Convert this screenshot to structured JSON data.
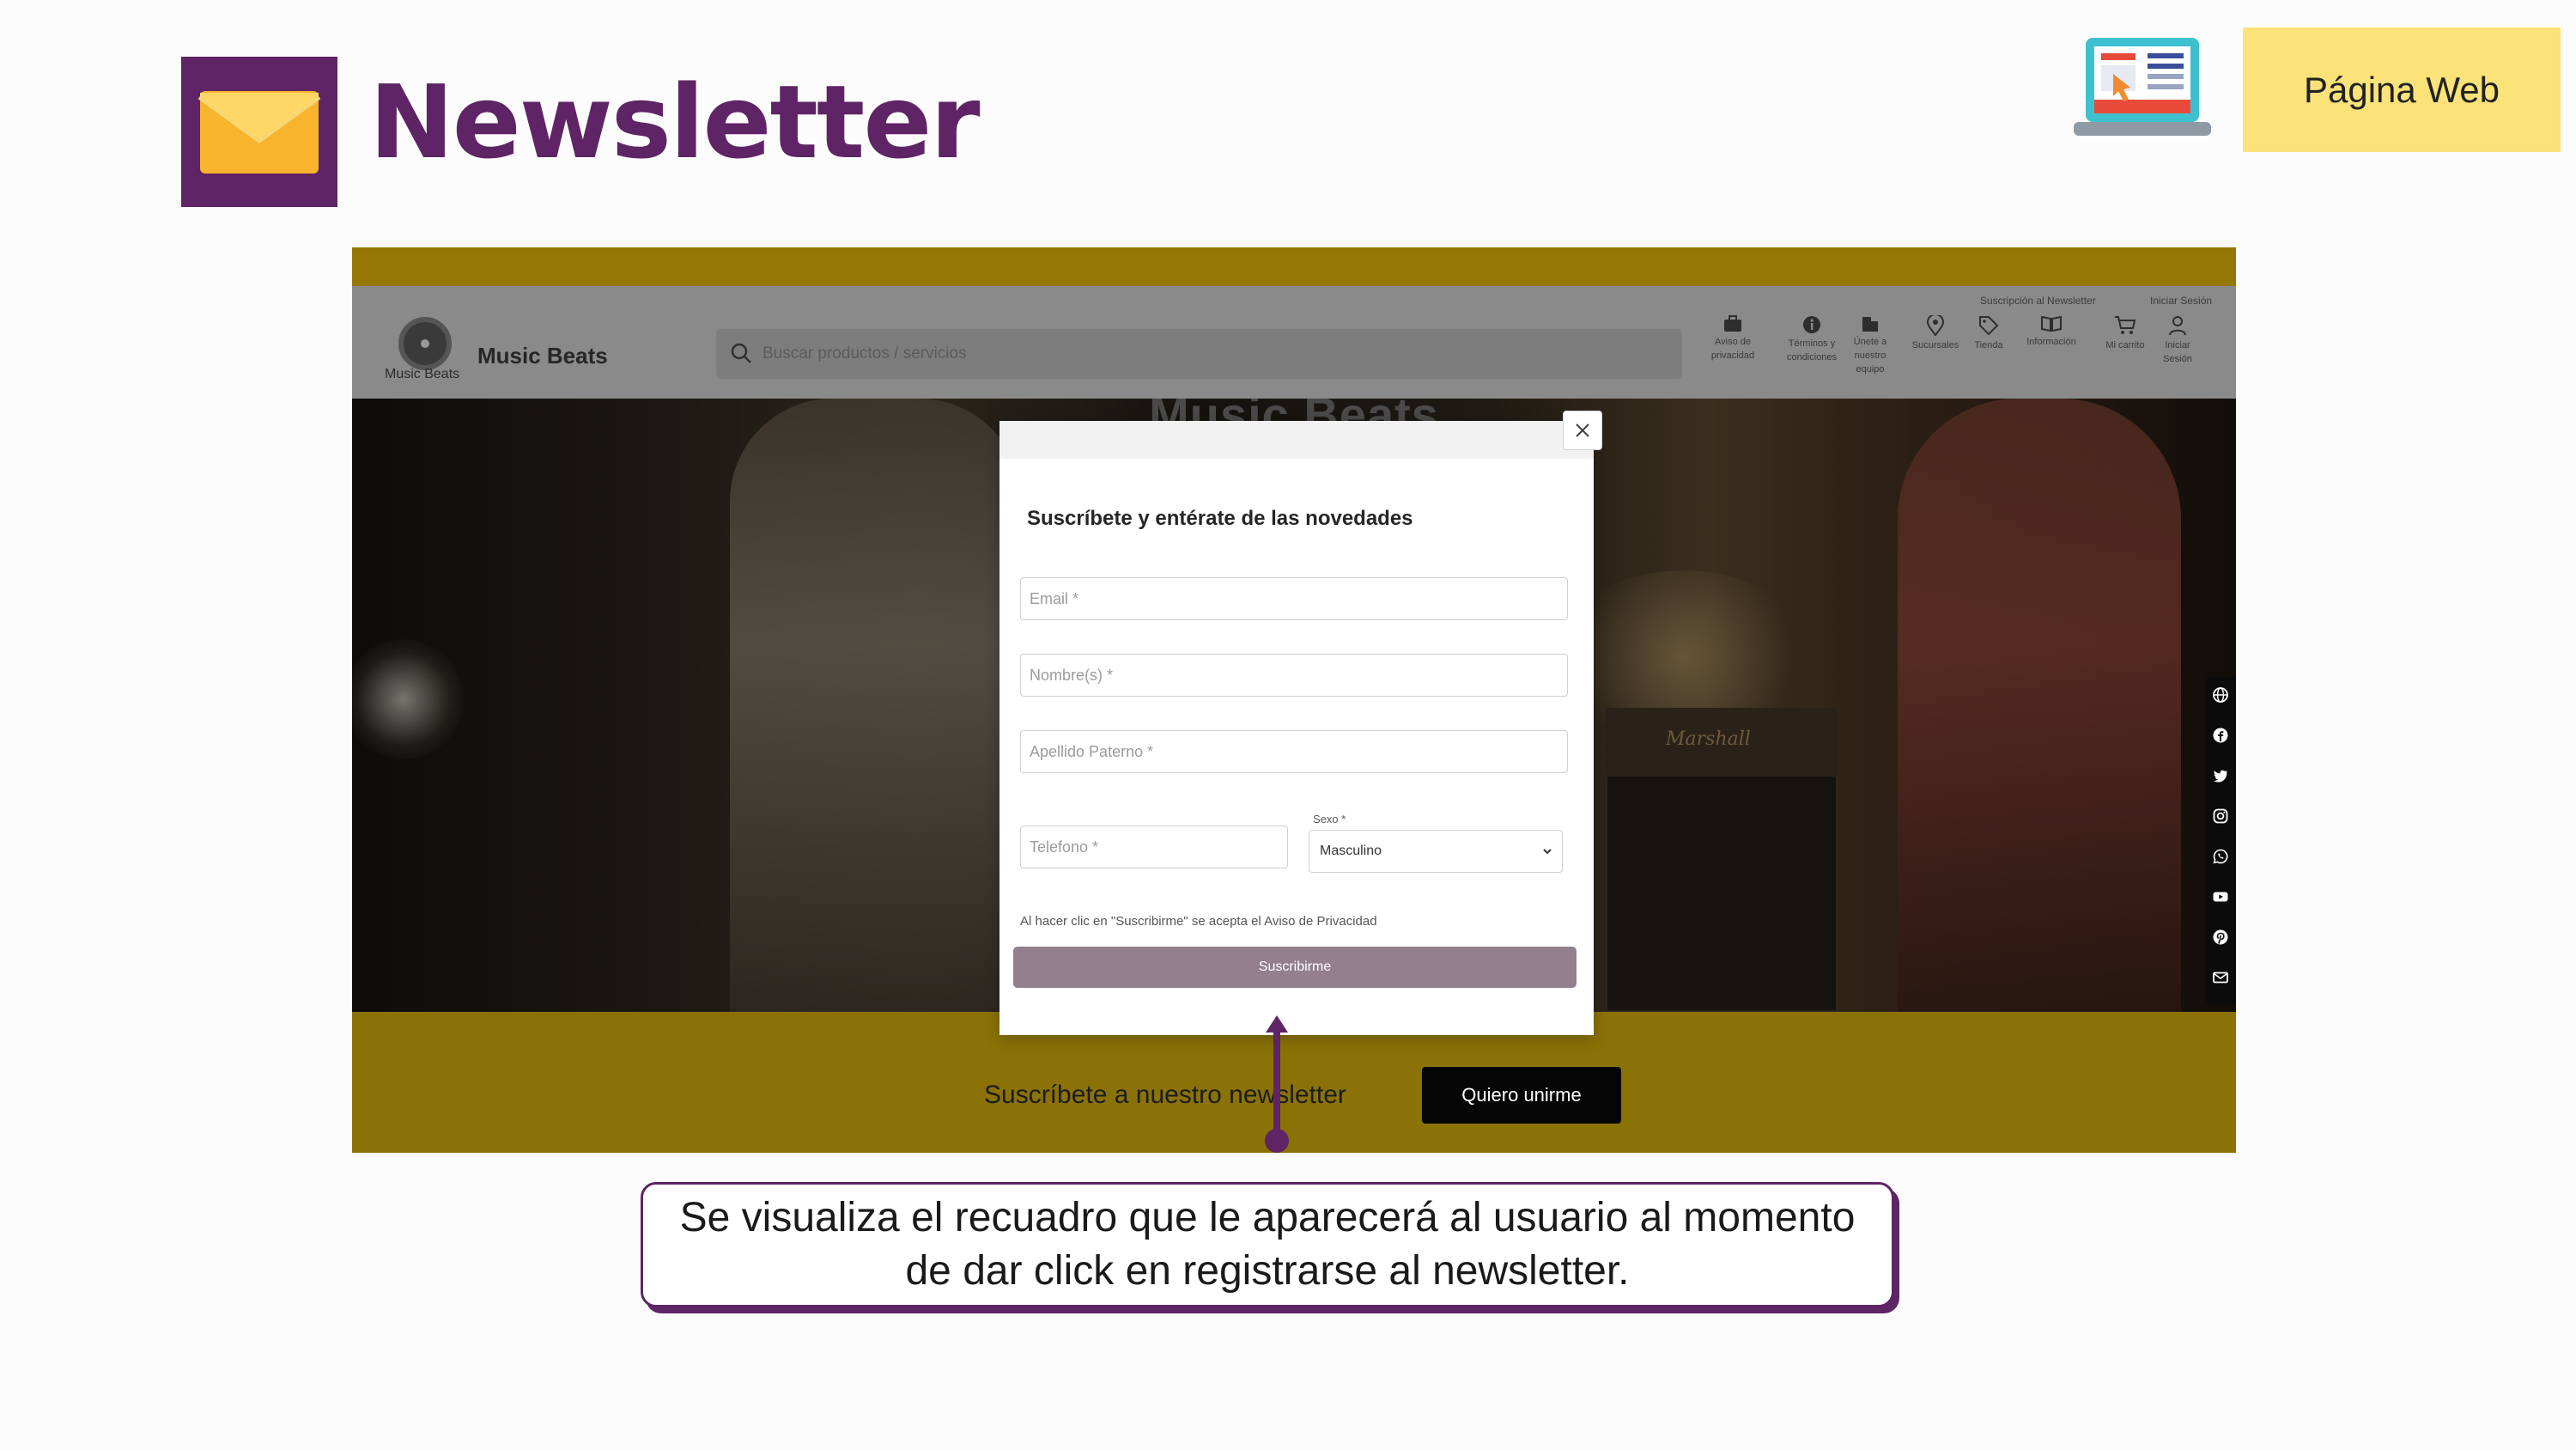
{
  "slide": {
    "title": "Newsletter",
    "section_badge": "Página Web",
    "callout": "Se visualiza el recuadro que le aparecerá al usuario al momento de dar click en registrarse al newsletter.",
    "icons": {
      "title_icon": "envelope-icon",
      "badge_icon": "laptop-web-icon"
    },
    "colors": {
      "brand_purple": "#5e2465",
      "badge_yellow": "#fbe37a",
      "site_mustard": "#8a7206"
    }
  },
  "site": {
    "brand": "Music Beats",
    "logo_caption": "Music Beats",
    "search_placeholder": "Buscar productos / servicios",
    "top_links": [
      "Suscripción al Newsletter",
      "Iniciar Sesión"
    ],
    "nav": [
      {
        "label": "Aviso de privacidad",
        "icon": "briefcase-icon"
      },
      {
        "label": "Términos y condiciones",
        "icon": "info-icon"
      },
      {
        "label": "Únete a nuestro equipo",
        "icon": "building-icon"
      },
      {
        "label": "Sucursales",
        "icon": "location-pin-icon"
      },
      {
        "label": "Tienda",
        "icon": "tag-icon"
      },
      {
        "label": "Información",
        "icon": "book-icon"
      },
      {
        "label": "Mi carrito",
        "icon": "cart-icon"
      },
      {
        "label": "Iniciar Sesión",
        "icon": "user-icon"
      }
    ],
    "hero_title": "Music Beats",
    "amp_brand": "Marshall",
    "social": [
      "globe-icon",
      "facebook-icon",
      "twitter-icon",
      "instagram-icon",
      "whatsapp-icon",
      "youtube-icon",
      "pinterest-icon",
      "mail-icon"
    ],
    "newsletter_text": "Suscríbete a nuestro newsletter",
    "newsletter_button": "Quiero unirme"
  },
  "modal": {
    "heading": "Suscríbete y entérate de las novedades",
    "email_placeholder": "Email *",
    "name_placeholder": "Nombre(s) *",
    "surname_placeholder": "Apellido Paterno *",
    "phone_placeholder": "Telefono *",
    "sex_label": "Sexo *",
    "sex_value": "Masculino",
    "privacy_note": "Al hacer clic en \"Suscribirme\" se acepta el Aviso de Privacidad",
    "submit_label": "Suscribirme"
  }
}
